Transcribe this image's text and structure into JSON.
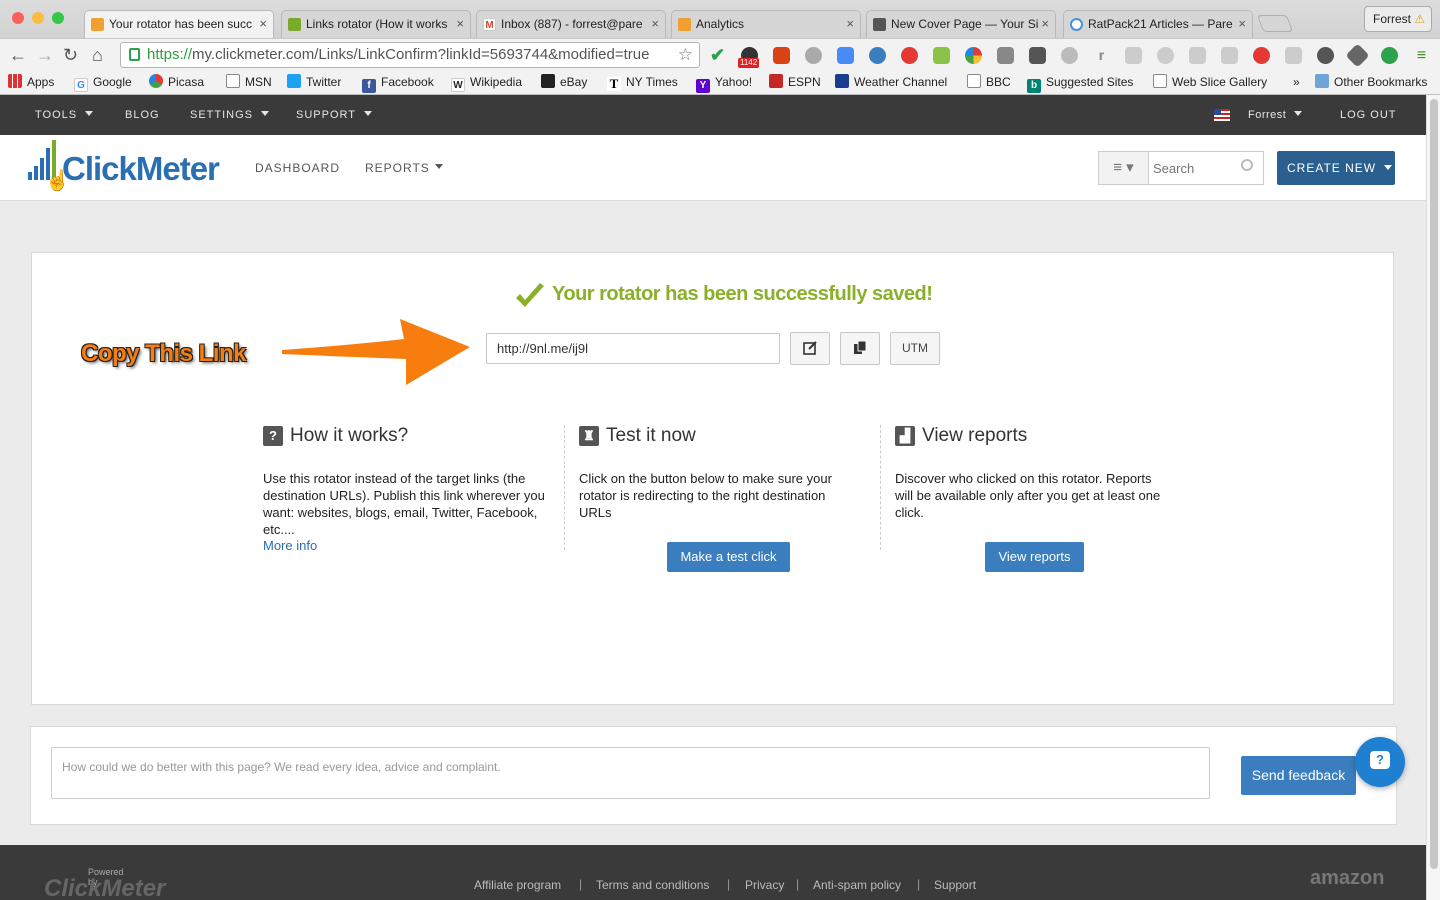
{
  "browser": {
    "tabs": [
      {
        "title": "Your rotator has been succ",
        "icon": "clickmeter-favicon",
        "color": "#f0a030"
      },
      {
        "title": "Links rotator (How it works",
        "icon": "clickmeter-favicon",
        "color": "#7aaa2a"
      },
      {
        "title": "Inbox (887) - forrest@pare",
        "icon": "gmail-favicon",
        "color": "#d14836"
      },
      {
        "title": "Analytics",
        "icon": "analytics-favicon",
        "color": "#f0a030"
      },
      {
        "title": "New Cover Page — Your Si",
        "icon": "page-favicon",
        "color": "#555555"
      },
      {
        "title": "RatPack21 Articles — Pare",
        "icon": "loading-favicon",
        "color": "#4a90d9"
      }
    ],
    "profile_name": "Forrest",
    "url_scheme": "https://",
    "url_rest": "my.clickmeter.com/Links/LinkConfirm?linkId=5693744&modified=true",
    "extension_badge": "1142",
    "bookmarks": [
      {
        "label": "Apps",
        "icon": "apps-grid-icon"
      },
      {
        "label": "Google",
        "icon": "google-icon"
      },
      {
        "label": "Picasa",
        "icon": "picasa-icon"
      },
      {
        "label": "MSN",
        "icon": "page-icon"
      },
      {
        "label": "Twitter",
        "icon": "twitter-icon"
      },
      {
        "label": "Facebook",
        "icon": "facebook-icon"
      },
      {
        "label": "Wikipedia",
        "icon": "wikipedia-icon"
      },
      {
        "label": "eBay",
        "icon": "ebay-icon"
      },
      {
        "label": "NY Times",
        "icon": "nytimes-icon"
      },
      {
        "label": "Yahoo!",
        "icon": "yahoo-icon"
      },
      {
        "label": "ESPN",
        "icon": "espn-icon"
      },
      {
        "label": "Weather Channel",
        "icon": "weather-icon"
      },
      {
        "label": "BBC",
        "icon": "page-icon"
      },
      {
        "label": "Suggested Sites",
        "icon": "bing-icon"
      },
      {
        "label": "Web Slice Gallery",
        "icon": "page-icon"
      }
    ],
    "bookmarks_overflow": "»",
    "other_bookmarks": "Other Bookmarks"
  },
  "topnav": {
    "tools": "TOOLS",
    "blog": "BLOG",
    "settings": "SETTINGS",
    "support": "SUPPORT",
    "user": "Forrest",
    "logout": "LOG OUT"
  },
  "header": {
    "logo_click": "Click",
    "logo_meter": "Meter",
    "dashboard": "DASHBOARD",
    "reports": "REPORTS",
    "search_placeholder": "Search",
    "create_new": "CREATE NEW"
  },
  "confirm": {
    "success_message": "Your rotator has been successfully saved!",
    "link_value": "http://9nl.me/ij9l",
    "utm_label": "UTM",
    "annotation": "Copy This Link"
  },
  "columns": [
    {
      "title": "How it works?",
      "icon": "question-icon",
      "text": "Use this rotator instead of the target links (the destination URLs). Publish this link wherever you want: websites, blogs, email, Twitter, Facebook, etc....",
      "link": "More info"
    },
    {
      "title": "Test it now",
      "icon": "flask-icon",
      "text": "Click on the button below to make sure your rotator is redirecting to the right destination URLs",
      "button": "Make a test click"
    },
    {
      "title": "View reports",
      "icon": "chart-icon",
      "text": "Discover who clicked on this rotator. Reports will be available only after you get at least one click.",
      "button": "View reports"
    }
  ],
  "feedback": {
    "placeholder": "How could we do better with this page? We read every idea, advice and complaint.",
    "send": "Send feedback"
  },
  "footer": {
    "powered_by": "Powered by",
    "brand": "ClickMeter",
    "links": [
      "Affiliate program",
      "Terms and conditions",
      "Privacy",
      "Anti-spam policy",
      "Support"
    ],
    "separator": "|",
    "hosting": "amazon"
  },
  "colors": {
    "brand_blue": "#2a6fb2",
    "brand_green": "#7aaa2a",
    "success_green": "#8ab02a",
    "button_blue": "#3a7ebf",
    "annotation_orange": "#f77e0e",
    "topnav_bg": "#3a3a3a"
  }
}
